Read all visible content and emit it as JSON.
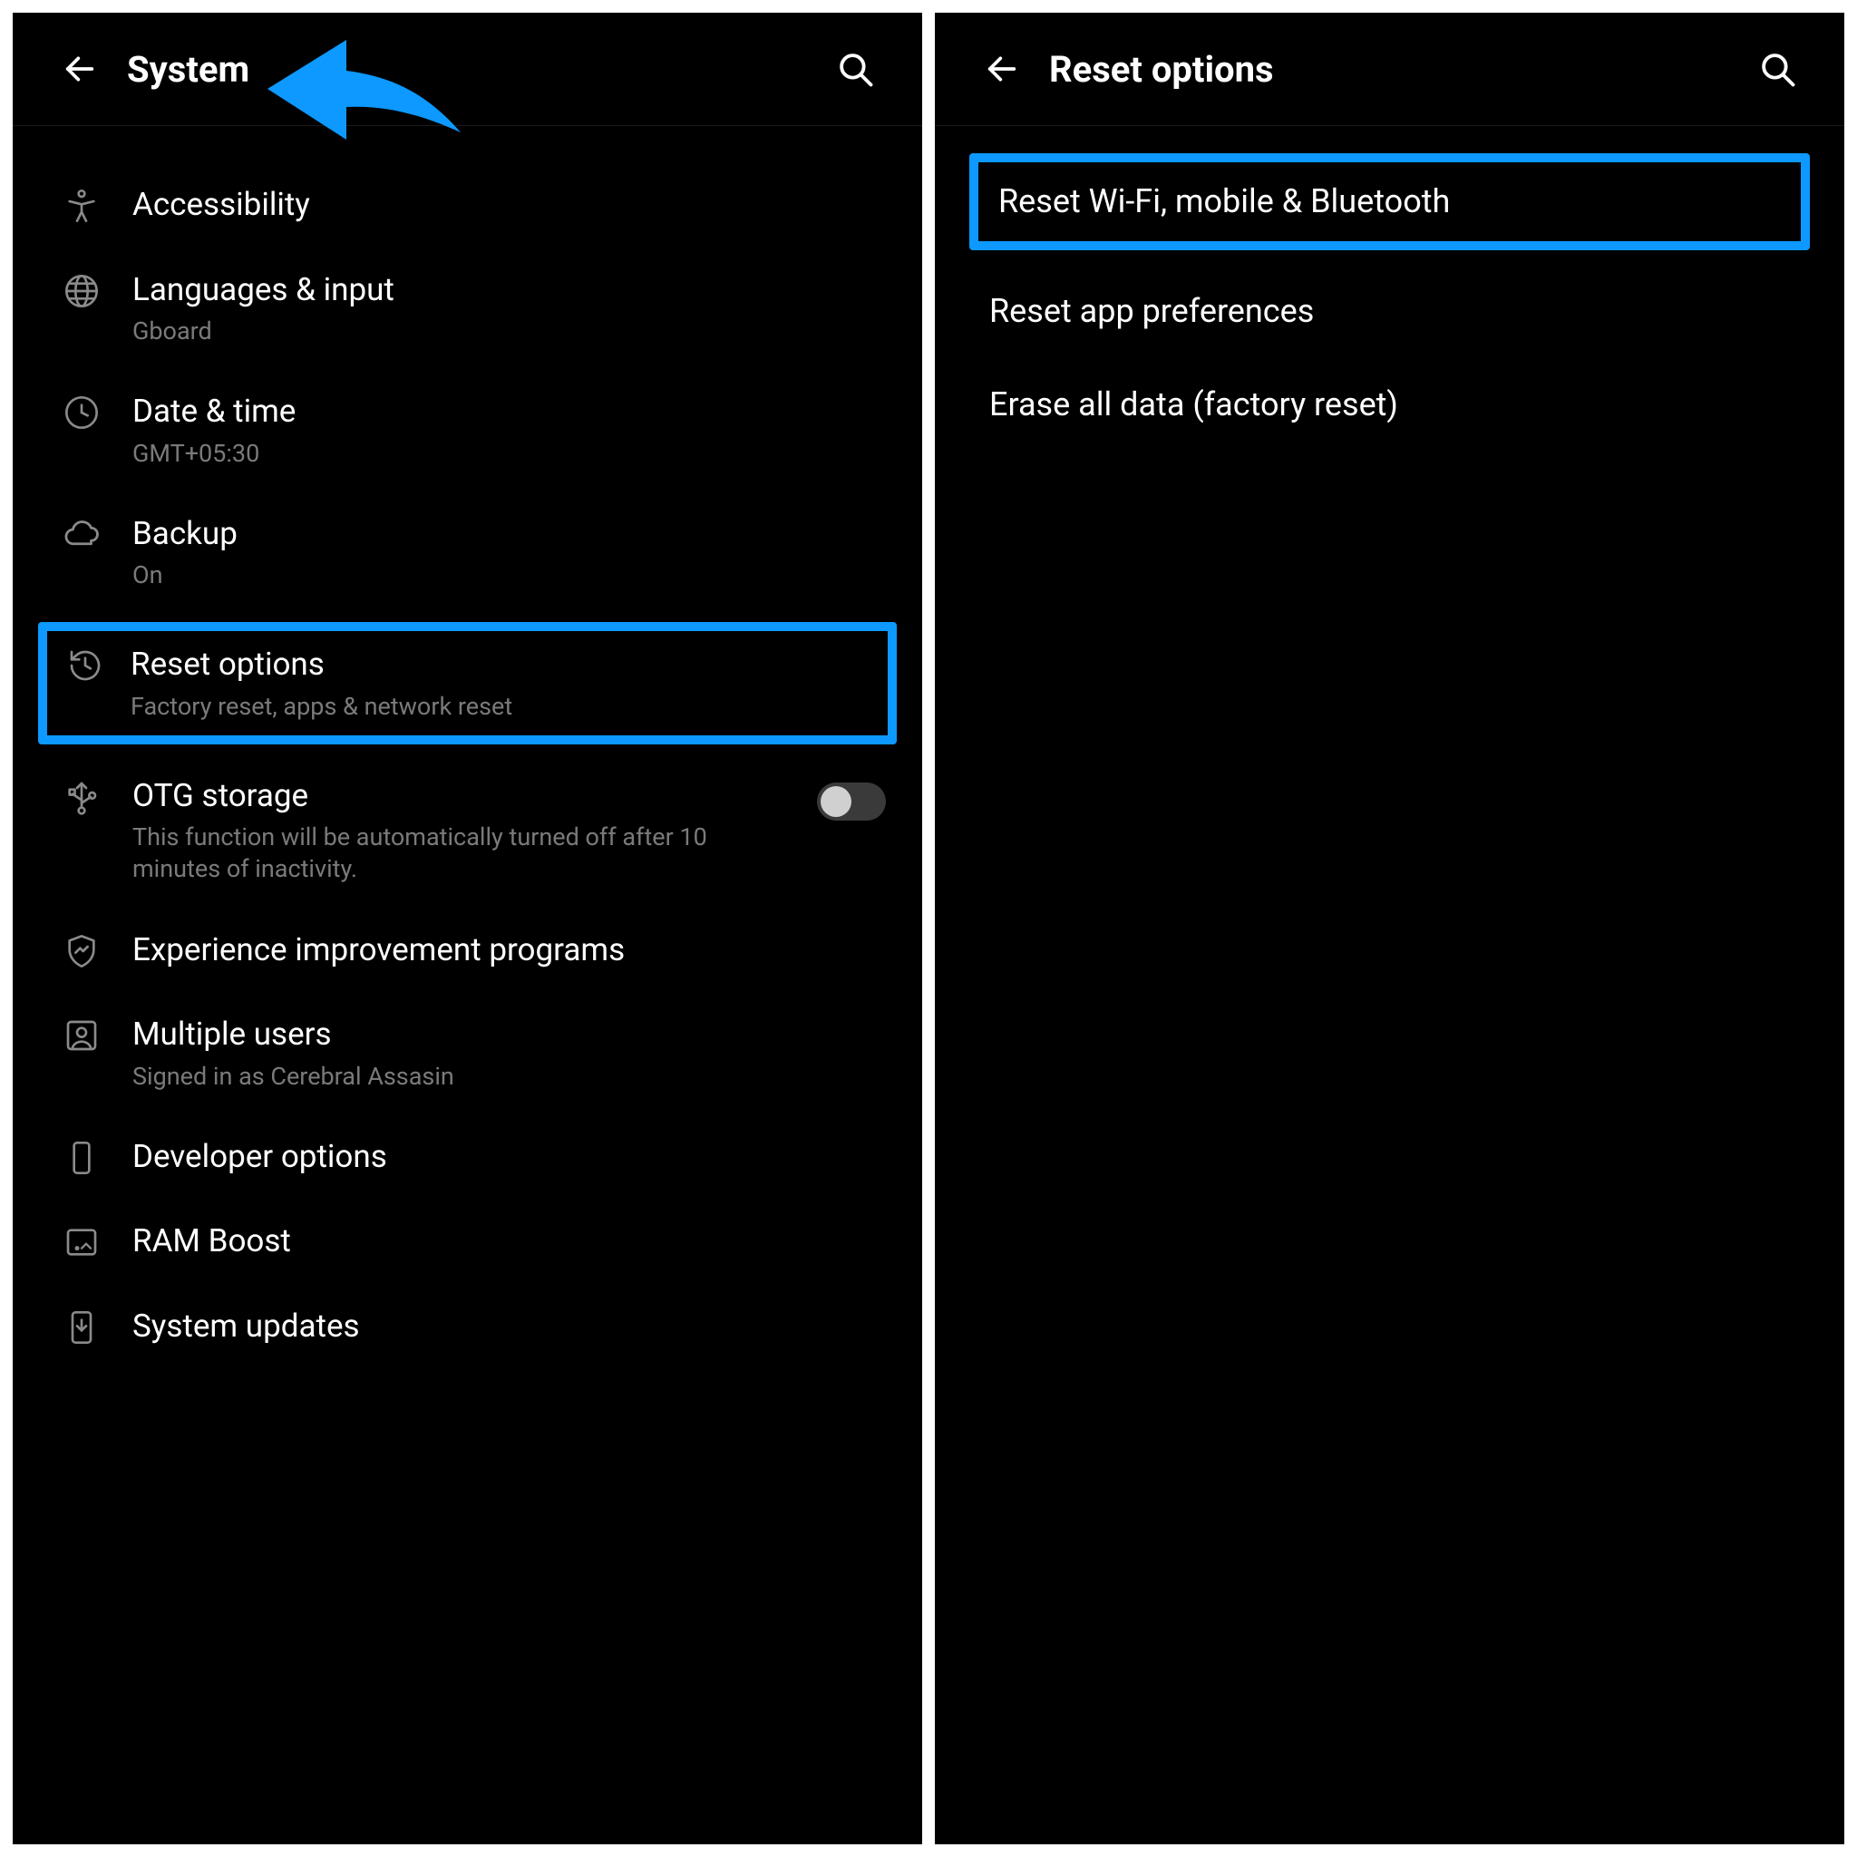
{
  "left": {
    "header_title": "System",
    "items": [
      {
        "icon": "accessibility",
        "title": "Accessibility"
      },
      {
        "icon": "globe",
        "title": "Languages & input",
        "subtitle": "Gboard"
      },
      {
        "icon": "clock",
        "title": "Date & time",
        "subtitle": "GMT+05:30"
      },
      {
        "icon": "cloud",
        "title": "Backup",
        "subtitle": "On"
      },
      {
        "icon": "history",
        "title": "Reset options",
        "subtitle": "Factory reset, apps & network reset",
        "highlight": true
      },
      {
        "icon": "usb",
        "title": "OTG storage",
        "subtitle": "This function will be automatically turned off after 10 minutes of inactivity.",
        "toggle": true
      },
      {
        "icon": "shield-up",
        "title": "Experience improvement programs"
      },
      {
        "icon": "person-box",
        "title": "Multiple users",
        "subtitle": "Signed in as Cerebral Assasin"
      },
      {
        "icon": "phone",
        "title": "Developer options"
      },
      {
        "icon": "ram",
        "title": "RAM Boost"
      },
      {
        "icon": "download-phone",
        "title": "System updates"
      }
    ]
  },
  "right": {
    "header_title": "Reset options",
    "items": [
      {
        "title": "Reset Wi-Fi, mobile & Bluetooth",
        "highlight": true
      },
      {
        "title": "Reset app preferences"
      },
      {
        "title": "Erase all data (factory reset)"
      }
    ]
  }
}
